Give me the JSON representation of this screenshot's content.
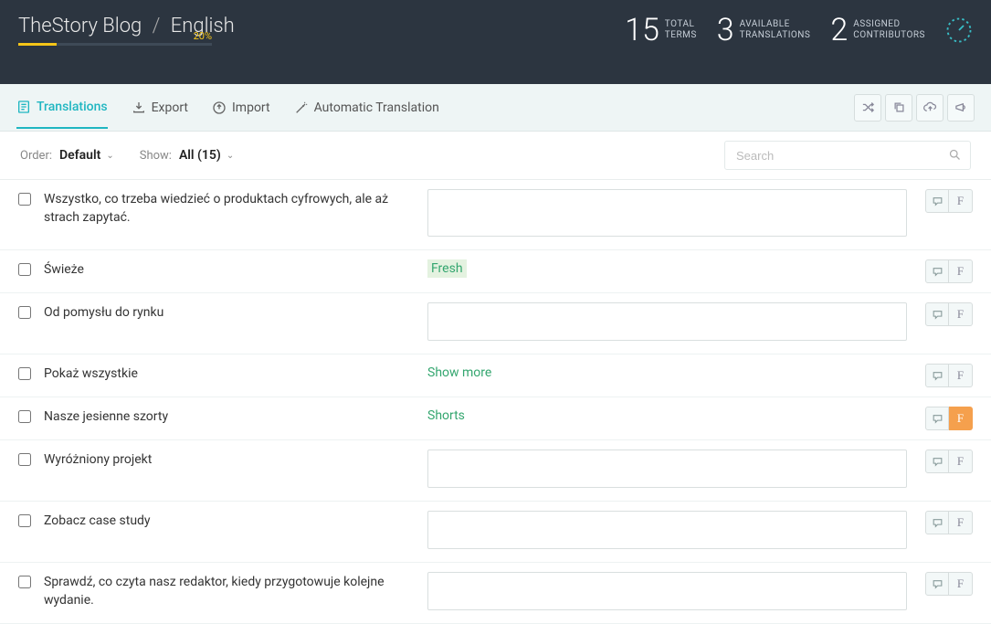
{
  "header": {
    "project": "TheStory Blog",
    "language": "English",
    "progress_pct": "20%",
    "stats": [
      {
        "num": "15",
        "line1": "TOTAL",
        "line2": "TERMS"
      },
      {
        "num": "3",
        "line1": "AVAILABLE",
        "line2": "TRANSLATIONS"
      },
      {
        "num": "2",
        "line1": "ASSIGNED",
        "line2": "CONTRIBUTORS"
      }
    ]
  },
  "tabs": {
    "translations": "Translations",
    "export": "Export",
    "import": "Import",
    "auto": "Automatic Translation"
  },
  "filters": {
    "order_label": "Order:",
    "order_value": "Default",
    "show_label": "Show:",
    "show_value": "All (15)",
    "search_placeholder": "Search"
  },
  "actions": {
    "fuzzy": "F"
  },
  "rows": [
    {
      "term": "Wszystko, co trzeba wiedzieć o produktach cyfrowych, ale aż strach zapytać.",
      "translation": "",
      "mode": "textarea",
      "tall": true,
      "flagged": false,
      "hl": false
    },
    {
      "term": "Świeże",
      "translation": "Fresh",
      "mode": "text",
      "flagged": false,
      "hl": true
    },
    {
      "term": "Od pomysłu do rynku",
      "translation": "",
      "mode": "textarea",
      "tall": false,
      "flagged": false,
      "hl": false
    },
    {
      "term": "Pokaż wszystkie",
      "translation": "Show more",
      "mode": "text",
      "flagged": false,
      "hl": false
    },
    {
      "term": "Nasze jesienne szorty",
      "translation": "Shorts",
      "mode": "text",
      "flagged": true,
      "hl": false
    },
    {
      "term": "Wyróżniony projekt",
      "translation": "",
      "mode": "textarea",
      "tall": false,
      "flagged": false,
      "hl": false
    },
    {
      "term": "Zobacz case study",
      "translation": "",
      "mode": "textarea",
      "tall": false,
      "flagged": false,
      "hl": false
    },
    {
      "term": "Sprawdź, co czyta nasz redaktor, kiedy przygotowuje kolejne wydanie.",
      "translation": "",
      "mode": "textarea",
      "tall": false,
      "flagged": false,
      "hl": false
    }
  ]
}
